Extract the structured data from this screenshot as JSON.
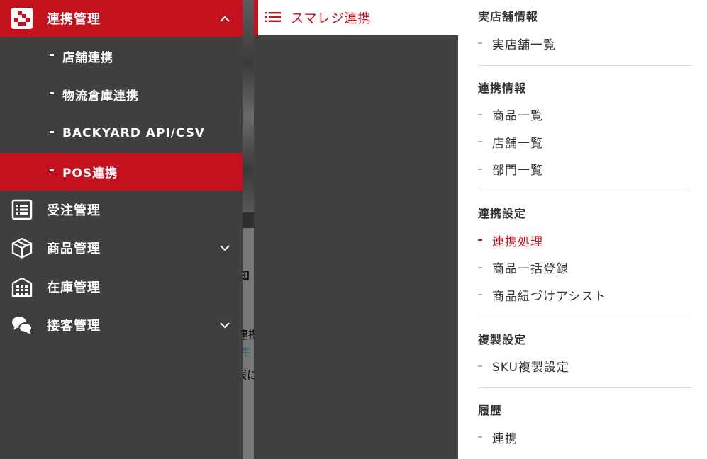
{
  "sidebar": {
    "active_group": {
      "label": "連携管理",
      "children": [
        {
          "label": "店舗連携"
        },
        {
          "label": "物流倉庫連携"
        },
        {
          "label": "BACKYARD API/CSV"
        },
        {
          "label": "POS連携",
          "active": true
        }
      ]
    },
    "items": [
      {
        "label": "受注管理",
        "icon": "order-list-icon",
        "has_chevron": false
      },
      {
        "label": "商品管理",
        "icon": "box-icon",
        "has_chevron": true
      },
      {
        "label": "在庫管理",
        "icon": "warehouse-icon",
        "has_chevron": false
      },
      {
        "label": "接客管理",
        "icon": "chat-bubbles-icon",
        "has_chevron": true
      }
    ]
  },
  "background_fragments": [
    "知",
    "連携",
    "件",
    "報に"
  ],
  "panel2": {
    "title": "スマレジ連携",
    "icon": "list-icon"
  },
  "submenu": {
    "sections": [
      {
        "title": "実店舗情報",
        "items": [
          {
            "label": "実店舗一覧"
          }
        ]
      },
      {
        "title": "連携情報",
        "items": [
          {
            "label": "商品一覧"
          },
          {
            "label": "店舗一覧"
          },
          {
            "label": "部門一覧"
          }
        ]
      },
      {
        "title": "連携設定",
        "items": [
          {
            "label": "連携処理",
            "current": true
          },
          {
            "label": "商品一括登録"
          },
          {
            "label": "商品紐づけアシスト"
          }
        ]
      },
      {
        "title": "複製設定",
        "items": [
          {
            "label": "SKU複製設定"
          }
        ]
      },
      {
        "title": "履歴",
        "items": [
          {
            "label": "連携"
          }
        ]
      }
    ]
  },
  "colors": {
    "accent": "#c3121d",
    "sidebar_bg": "#3f3f3f",
    "text": "#333333"
  }
}
